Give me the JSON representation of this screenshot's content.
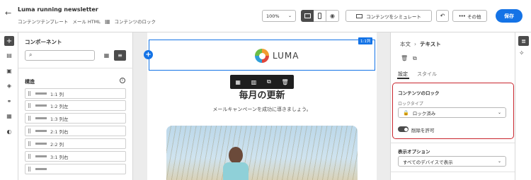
{
  "header": {
    "title": "Luma running newsletter",
    "sub_template": "コンテンツテンプレート",
    "sub_mode": "メール HTML",
    "sub_lock": "コンテンツのロック",
    "zoom": "100%",
    "simulate": "コンテンツをシミュレート",
    "more": "その他",
    "save": "保存"
  },
  "components": {
    "title": "コンポーネント",
    "section": "構造",
    "items": [
      "1:1 列",
      "1:2 列左",
      "1:3 列左",
      "2:1 列右",
      "2:2 列",
      "3:1 列右"
    ]
  },
  "canvas": {
    "row_tag": "1:1列",
    "logo_text": "LUMA",
    "headline": "毎月の更新",
    "subtext": "メールキャンペーンを成功に導きましょう。"
  },
  "props": {
    "breadcrumb_root": "本文",
    "breadcrumb_sep": "›",
    "breadcrumb_current": "テキスト",
    "tab_settings": "設定",
    "tab_style": "スタイル",
    "lock_title": "コンテンツのロック",
    "lock_type_label": "ロックタイプ",
    "lock_type_value": "ロック済み",
    "allow_delete": "削除を許可",
    "display_title": "表示オプション",
    "display_value": "すべてのデバイスで表示"
  },
  "colors": {
    "accent": "#1473e6",
    "lock_border": "#c9252d",
    "save_bg": "#1473e6",
    "toolbar_bg": "#1f1f1f"
  }
}
